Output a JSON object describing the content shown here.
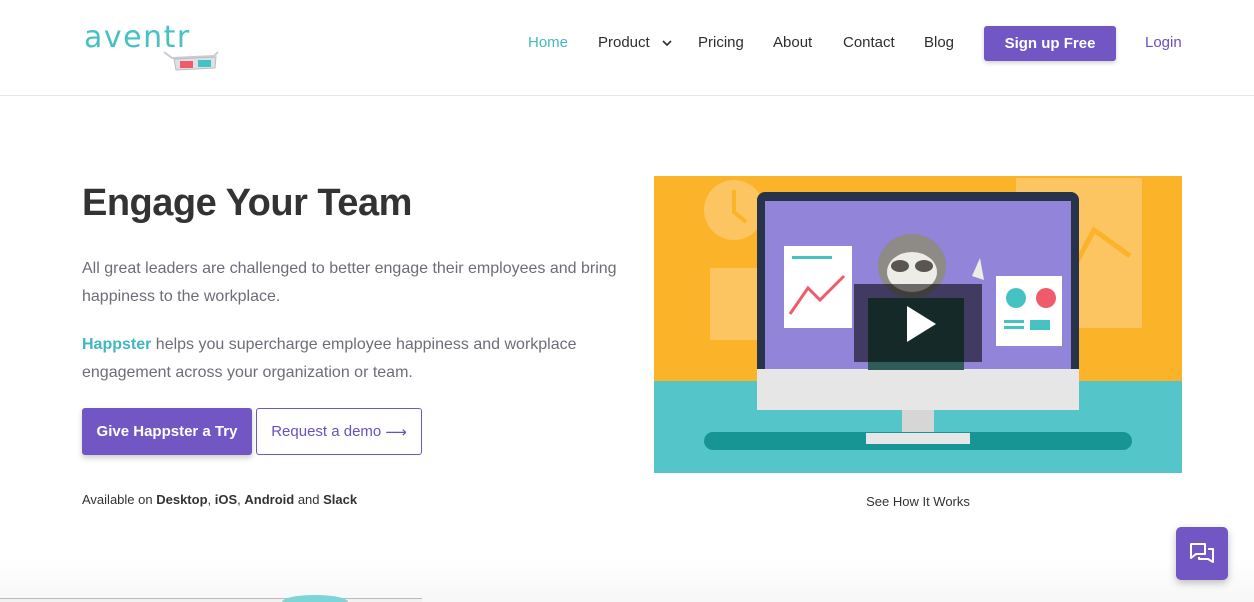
{
  "brand": {
    "logo_text": "aventr",
    "accent_color": "#47c2c4",
    "primary_color": "#7256c4"
  },
  "nav": {
    "items": [
      {
        "label": "Home",
        "active": true
      },
      {
        "label": "Product",
        "has_dropdown": true
      },
      {
        "label": "Pricing"
      },
      {
        "label": "About"
      },
      {
        "label": "Contact"
      },
      {
        "label": "Blog"
      }
    ],
    "signup_label": "Sign up Free",
    "login_label": "Login"
  },
  "hero": {
    "title": "Engage Your Team",
    "paragraph1": "All great leaders are challenged to better engage their employees and bring happiness to the workplace.",
    "brand_word": "Happster",
    "paragraph2_rest": " helps you supercharge employee happiness and workplace engagement across your organization or team.",
    "try_button": "Give Happster a Try",
    "demo_button": "Request a demo",
    "demo_arrow": "⟶",
    "available_prefix": "Available on ",
    "platforms": [
      "Desktop",
      "iOS",
      "Android",
      "Slack"
    ],
    "sep_comma": ", ",
    "sep_and": " and "
  },
  "video": {
    "caption": "See How It Works",
    "icon": "play-icon"
  },
  "chat": {
    "icon": "chat-icon"
  }
}
